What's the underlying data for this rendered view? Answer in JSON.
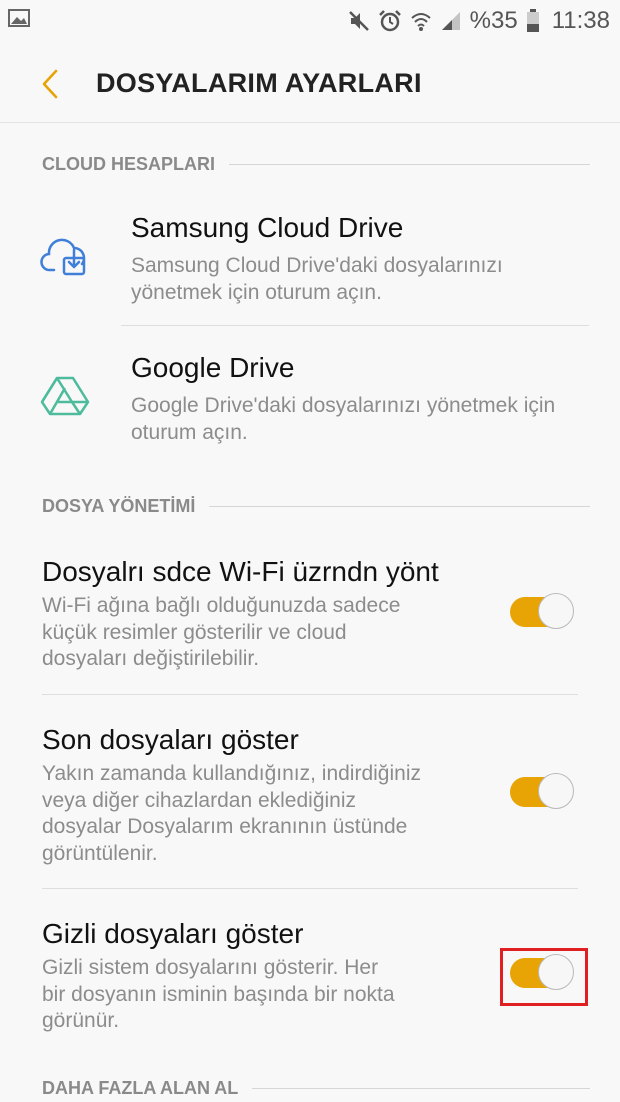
{
  "status_bar": {
    "battery_text": "%35",
    "time": "11:38",
    "icons": [
      "image-notification-icon",
      "mute-icon",
      "alarm-icon",
      "wifi-icon",
      "signal-icon",
      "battery-icon"
    ]
  },
  "header": {
    "title": "DOSYALARIM AYARLARI",
    "back_icon": "chevron-left-icon",
    "accent_color": "#e8a305"
  },
  "sections": {
    "cloud": {
      "header": "CLOUD HESAPLARI",
      "items": [
        {
          "title": "Samsung Cloud Drive",
          "subtitle_line1": "Samsung Cloud Drive'daki dosyalarınızı",
          "subtitle_line2": "yönetmek için oturum açın.",
          "icon": "samsung-cloud-icon",
          "icon_color": "#3f7fd9"
        },
        {
          "title": "Google Drive",
          "subtitle_line1": "Google Drive'daki dosyalarınızı yönetmek için",
          "subtitle_line2": "oturum açın.",
          "icon": "google-drive-icon",
          "icon_color": "#4dbb9c"
        }
      ]
    },
    "file_management": {
      "header": "DOSYA YÖNETİMİ",
      "items": [
        {
          "title": "Dosyalrı sdce Wi-Fi üzrndn yönt",
          "subtitle_lines": [
            "Wi-Fi ağına bağlı olduğunuzda sadece",
            "küçük resimler gösterilir ve cloud",
            "dosyaları değiştirilebilir."
          ],
          "toggle_on": true
        },
        {
          "title": "Son dosyaları göster",
          "subtitle_lines": [
            "Yakın zamanda kullandığınız, indirdiğiniz",
            "veya diğer cihazlardan eklediğiniz",
            "dosyalar Dosyalarım ekranının üstünde",
            "görüntülenir."
          ],
          "toggle_on": true
        },
        {
          "title": "Gizli dosyaları göster",
          "subtitle_lines": [
            "Gizli sistem dosyalarını gösterir. Her",
            "bir dosyanın isminin başında bir nokta",
            "görünür."
          ],
          "toggle_on": true,
          "highlighted": true
        }
      ]
    },
    "more_space": {
      "header": "DAHA FAZLA ALAN AL"
    }
  },
  "colors": {
    "toggle_on": "#e8a305",
    "highlight": "#e02020",
    "secondary_text": "#8c8c8c"
  }
}
